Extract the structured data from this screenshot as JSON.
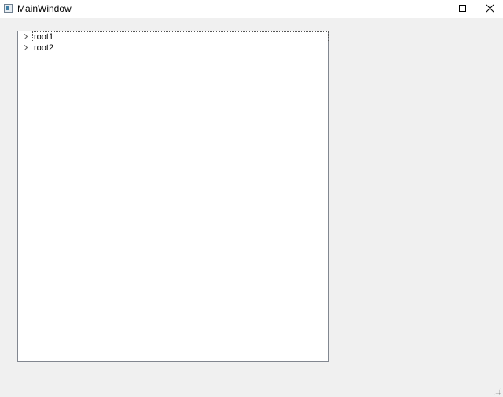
{
  "window": {
    "title": "MainWindow",
    "controls": [
      "minimize-icon",
      "maximize-icon",
      "close-icon"
    ]
  },
  "tree": {
    "items": [
      {
        "label": "root1",
        "expanded": false,
        "focused": true
      },
      {
        "label": "root2",
        "expanded": false,
        "focused": false
      }
    ]
  }
}
